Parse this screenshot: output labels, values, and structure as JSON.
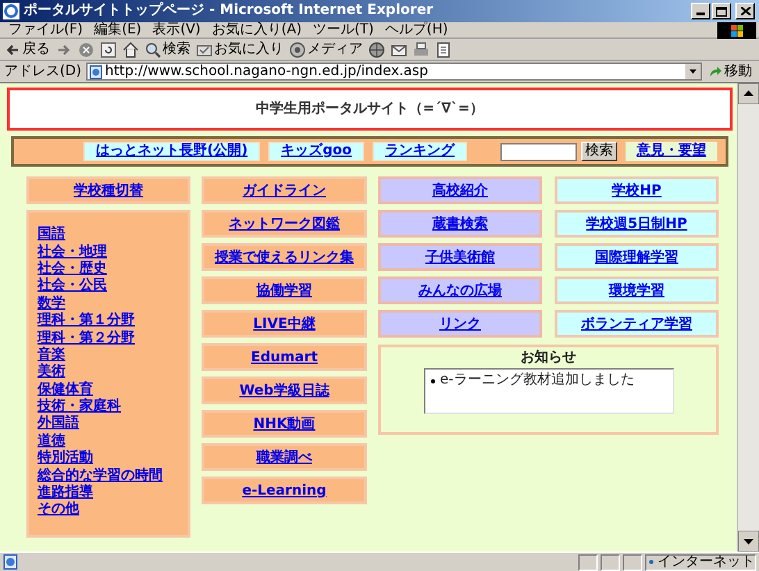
{
  "window": {
    "title": "ポータルサイトトップページ - Microsoft Internet Explorer"
  },
  "menu": [
    "ファイル(F)",
    "編集(E)",
    "表示(V)",
    "お気に入り(A)",
    "ツール(T)",
    "ヘルプ(H)"
  ],
  "toolbar": [
    {
      "kind": "back",
      "label": "戻る"
    },
    {
      "kind": "forward"
    },
    {
      "kind": "stop"
    },
    {
      "kind": "refresh"
    },
    {
      "kind": "home"
    },
    {
      "kind": "search",
      "label": "検索"
    },
    {
      "kind": "favorites",
      "label": "お気に入り"
    },
    {
      "kind": "media",
      "label": "メディア"
    },
    {
      "kind": "history"
    },
    {
      "kind": "mail"
    },
    {
      "kind": "print"
    },
    {
      "kind": "edit"
    }
  ],
  "address": {
    "label": "アドレス(D)",
    "url": "http://www.school.nagano-ngn.ed.jp/index.asp",
    "go": "移動"
  },
  "page": {
    "header": "中学生用ポータルサイト（=´∇`=）",
    "nav_links": [
      "はっとネット長野(公開)",
      "キッズgoo",
      "ランキング"
    ],
    "search_button": "検索",
    "feedback_link": "意見・要望",
    "grade_switch": "学校種切替",
    "subjects": [
      "国語",
      "社会・地理",
      "社会・歴史",
      "社会・公民",
      "数学",
      "理科・第１分野",
      "理科・第２分野",
      "音楽",
      "美術",
      "保健体育",
      "技術・家庭科",
      "外国語",
      "道徳",
      "特別活動",
      "総合的な学習の時間",
      "進路指導",
      "その他"
    ],
    "column_2": [
      "ガイドライン",
      "ネットワーク図鑑",
      "授業で使えるリンク集",
      "協働学習",
      "LIVE中継",
      "Edumart",
      "Web学級日誌",
      "NHK動画",
      "職業調べ",
      "e-Learning"
    ],
    "column_3": [
      "高校紹介",
      "蔵書検索",
      "子供美術館",
      "みんなの広場",
      "リンク"
    ],
    "column_4": [
      "学校HP",
      "学校週5日制HP",
      "国際理解学習",
      "環境学習",
      "ボランティア学習"
    ],
    "notice": {
      "title": "お知らせ",
      "items": [
        "e-ラーニング教材追加しました"
      ]
    }
  },
  "status_bar": {
    "zone": "インターネット"
  }
}
